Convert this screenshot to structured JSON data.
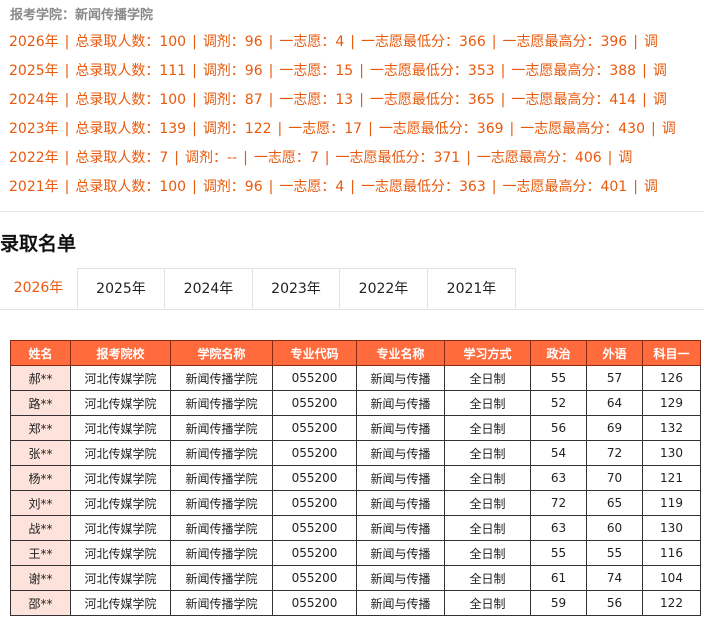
{
  "college_line": "报考学院：新闻传播学院",
  "stats": [
    {
      "year": "2026年",
      "total": "总录取人数：100",
      "adjust": "调剂：96",
      "first": "一志愿：4",
      "min": "一志愿最低分：366",
      "max": "一志愿最高分：396",
      "trail": "调"
    },
    {
      "year": "2025年",
      "total": "总录取人数：111",
      "adjust": "调剂：96",
      "first": "一志愿：15",
      "min": "一志愿最低分：353",
      "max": "一志愿最高分：388",
      "trail": "调"
    },
    {
      "year": "2024年",
      "total": "总录取人数：100",
      "adjust": "调剂：87",
      "first": "一志愿：13",
      "min": "一志愿最低分：365",
      "max": "一志愿最高分：414",
      "trail": "调"
    },
    {
      "year": "2023年",
      "total": "总录取人数：139",
      "adjust": "调剂：122",
      "first": "一志愿：17",
      "min": "一志愿最低分：369",
      "max": "一志愿最高分：430",
      "trail": "调"
    },
    {
      "year": "2022年",
      "total": "总录取人数：7",
      "adjust": "调剂：--",
      "first": "一志愿：7",
      "min": "一志愿最低分：371",
      "max": "一志愿最高分：406",
      "trail": "调"
    },
    {
      "year": "2021年",
      "total": "总录取人数：100",
      "adjust": "调剂：96",
      "first": "一志愿：4",
      "min": "一志愿最低分：363",
      "max": "一志愿最高分：401",
      "trail": "调"
    }
  ],
  "section_title": "录取名单",
  "tabs": [
    "2026年",
    "2025年",
    "2024年",
    "2023年",
    "2022年",
    "2021年"
  ],
  "active_tab": 0,
  "table": {
    "headers": [
      "姓名",
      "报考院校",
      "学院名称",
      "专业代码",
      "专业名称",
      "学习方式",
      "政治",
      "外语",
      "科目一"
    ],
    "rows": [
      [
        "郝**",
        "河北传媒学院",
        "新闻传播学院",
        "055200",
        "新闻与传播",
        "全日制",
        "55",
        "57",
        "126"
      ],
      [
        "路**",
        "河北传媒学院",
        "新闻传播学院",
        "055200",
        "新闻与传播",
        "全日制",
        "52",
        "64",
        "129"
      ],
      [
        "郑**",
        "河北传媒学院",
        "新闻传播学院",
        "055200",
        "新闻与传播",
        "全日制",
        "56",
        "69",
        "132"
      ],
      [
        "张**",
        "河北传媒学院",
        "新闻传播学院",
        "055200",
        "新闻与传播",
        "全日制",
        "54",
        "72",
        "130"
      ],
      [
        "杨**",
        "河北传媒学院",
        "新闻传播学院",
        "055200",
        "新闻与传播",
        "全日制",
        "63",
        "70",
        "121"
      ],
      [
        "刘**",
        "河北传媒学院",
        "新闻传播学院",
        "055200",
        "新闻与传播",
        "全日制",
        "72",
        "65",
        "119"
      ],
      [
        "战**",
        "河北传媒学院",
        "新闻传播学院",
        "055200",
        "新闻与传播",
        "全日制",
        "63",
        "60",
        "130"
      ],
      [
        "王**",
        "河北传媒学院",
        "新闻传播学院",
        "055200",
        "新闻与传播",
        "全日制",
        "55",
        "55",
        "116"
      ],
      [
        "谢**",
        "河北传媒学院",
        "新闻传播学院",
        "055200",
        "新闻与传播",
        "全日制",
        "61",
        "74",
        "104"
      ],
      [
        "邵**",
        "河北传媒学院",
        "新闻传播学院",
        "055200",
        "新闻与传播",
        "全日制",
        "59",
        "56",
        "122"
      ]
    ]
  },
  "colors": {
    "accent": "#e8590c",
    "header_bg": "#ff6b3d",
    "name_cell_bg": "#fde3dc"
  }
}
